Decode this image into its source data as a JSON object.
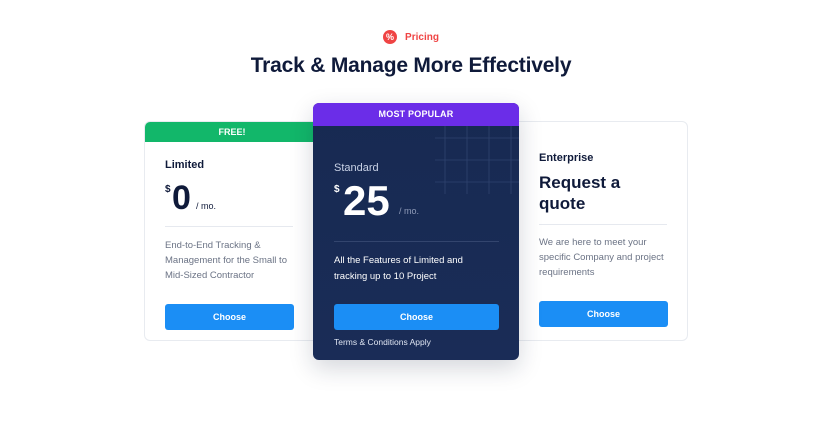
{
  "section": {
    "eyebrow_icon": "%",
    "eyebrow": "Pricing",
    "headline": "Track & Manage More Effectively"
  },
  "plans": [
    {
      "ribbon": "FREE!",
      "name": "Limited",
      "currency": "$",
      "price": "0",
      "period": "/ mo.",
      "description": "End-to-End Tracking & Management for the Small to Mid-Sized Contractor",
      "cta": "Choose"
    },
    {
      "ribbon": "MOST POPULAR",
      "name": "Standard",
      "currency": "$",
      "price": "25",
      "period": "/ mo.",
      "description": "All the Features of Limited and tracking up to 10 Project",
      "cta": "Choose",
      "footnote": "Terms & Conditions Apply"
    },
    {
      "name": "Enterprise",
      "title": "Request a quote",
      "description": "We are here to meet your specific Company and project requirements",
      "cta": "Choose"
    }
  ],
  "colors": {
    "accent_red": "#ef4444",
    "free_green": "#12b76a",
    "popular_purple": "#6b2de8",
    "dark_navy": "#172a52",
    "button_blue": "#1b8ef5"
  }
}
